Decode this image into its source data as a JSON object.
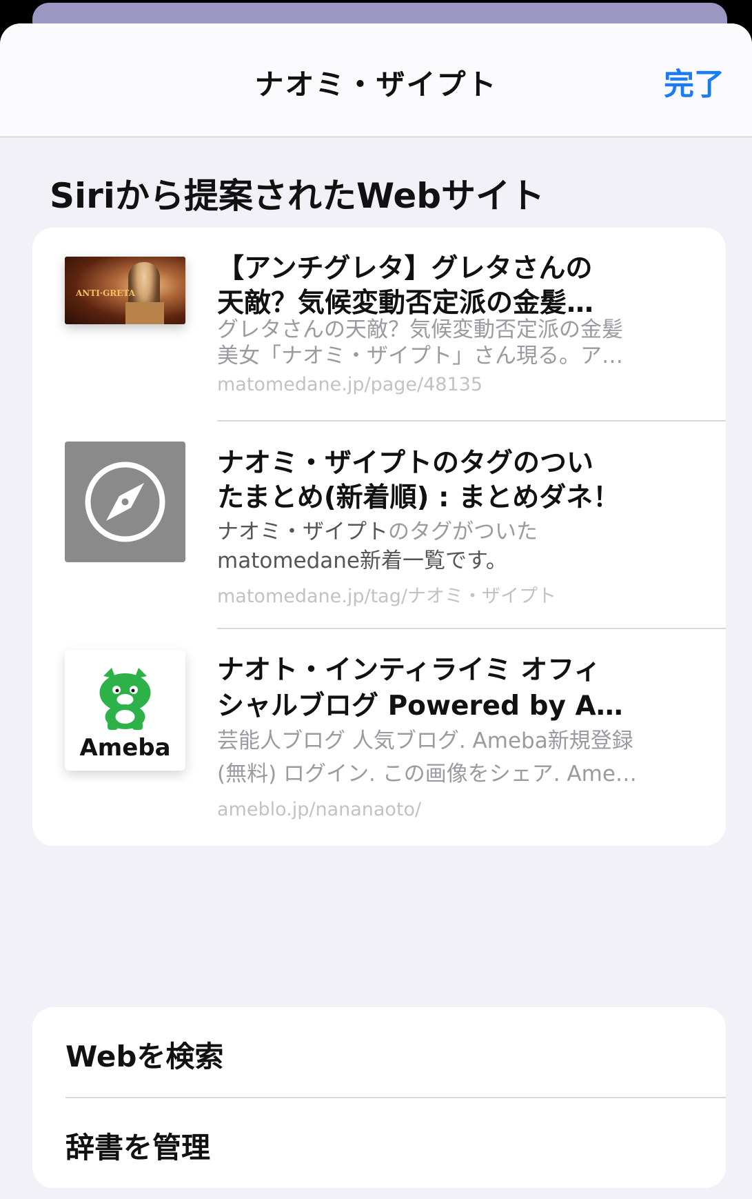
{
  "header": {
    "title": "ナオミ・ザイプト",
    "done_label": "完了"
  },
  "section": {
    "title": "Siriから提案されたWebサイト"
  },
  "results": [
    {
      "thumb": "article-photo",
      "title_line1": "【アンチグレタ】グレタさんの",
      "title_line2": "天敵？気候変動否定派の金髪…",
      "desc_line1": "グレタさんの天敵？気候変動否定派の金髪",
      "desc_line2": "美女「ナオミ・ザイプト」さん現る。ア…",
      "url": "matomedane.jp/page/48135"
    },
    {
      "thumb": "compass-icon",
      "title_line1": "ナオミ・ザイプトのタグのつい",
      "title_line2": "たまとめ(新着順) : まとめダネ！",
      "desc_line1_highlight": "ナオミ・ザイプト",
      "desc_line1_rest": "のタグがついた",
      "desc_line2_highlight": "matomedane",
      "desc_line2_rest": "新着一覧です。",
      "url": "matomedane.jp/tag/ナオミ・ザイプト"
    },
    {
      "thumb": "ameba-logo",
      "thumb_text": "Ameba",
      "title_line1": "ナオト・インティライミ オフィ",
      "title_line2": "シャルブログ Powered by A…",
      "desc_line1": "芸能人ブログ 人気ブログ. Ameba新規登録",
      "desc_line2": "(無料) ログイン. この画像をシェア. Ame…",
      "url": "ameblo.jp/nananaoto/"
    }
  ],
  "actions": {
    "search_web": "Webを検索",
    "manage_dictionary": "辞書を管理"
  },
  "colors": {
    "accent": "#1a7cf5",
    "background": "#f2f1f7",
    "card": "#ffffff"
  }
}
